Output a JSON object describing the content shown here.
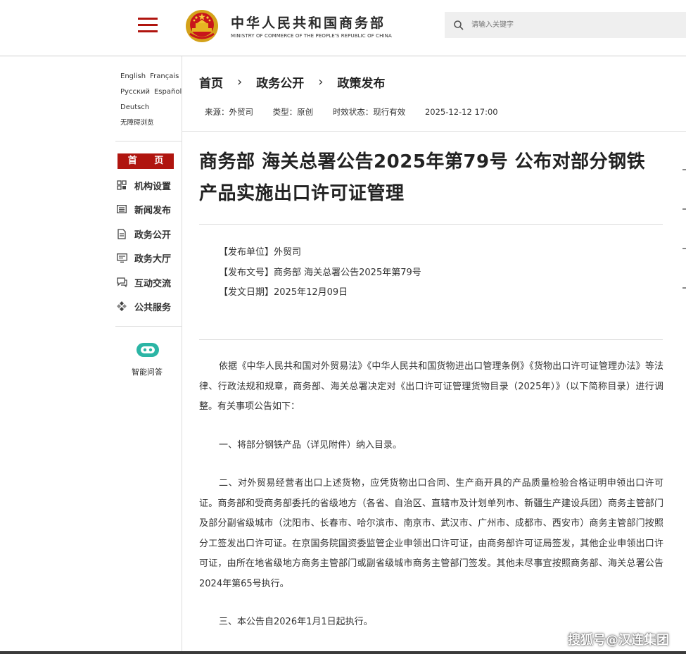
{
  "header": {
    "site_name_cn": "中华人民共和国商务部",
    "site_name_en": "MINISTRY OF COMMERCE OF THE PEOPLE'S REPUBLIC OF CHINA",
    "search_placeholder": "请输入关键字"
  },
  "sidebar": {
    "languages": [
      "English",
      "Français",
      "Русский",
      "Español",
      "Deutsch"
    ],
    "accessibility": "无障碍浏览",
    "home": "首 页",
    "nav": [
      {
        "label": "机构设置",
        "icon": "org-structure-icon"
      },
      {
        "label": "新闻发布",
        "icon": "news-icon"
      },
      {
        "label": "政务公开",
        "icon": "document-icon"
      },
      {
        "label": "政务大厅",
        "icon": "service-hall-icon"
      },
      {
        "label": "互动交流",
        "icon": "chat-icon"
      },
      {
        "label": "公共服务",
        "icon": "public-service-icon"
      }
    ],
    "assistant_label": "智能问答"
  },
  "breadcrumb": [
    "首页",
    "政务公开",
    "政策发布"
  ],
  "meta": {
    "source": "来源：外贸司",
    "type": "类型：原创",
    "status": "时效状态：现行有效",
    "date": "2025-12-12 17:00"
  },
  "article": {
    "title": "商务部 海关总署公告2025年第79号 公布对部分钢铁产品实施出口许可证管理",
    "info": [
      "【发布单位】外贸司",
      "【发布文号】商务部 海关总署公告2025年第79号",
      "【发文日期】2025年12月09日"
    ],
    "paragraphs": [
      "依据《中华人民共和国对外贸易法》《中华人民共和国货物进出口管理条例》《货物出口许可证管理办法》等法律、行政法规和规章，商务部、海关总署决定对《出口许可证管理货物目录（2025年）》（以下简称目录）进行调整。有关事项公告如下：",
      "一、将部分钢铁产品（详见附件）纳入目录。",
      "二、对外贸易经营者出口上述货物，应凭货物出口合同、生产商开具的产品质量检验合格证明申领出口许可证。商务部和受商务部委托的省级地方（各省、自治区、直辖市及计划单列市、新疆生产建设兵团）商务主管部门及部分副省级城市（沈阳市、长春市、哈尔滨市、南京市、武汉市、广州市、成都市、西安市）商务主管部门按照分工签发出口许可证。在京国务院国资委监管企业申领出口许可证，由商务部许可证局签发，其他企业申领出口许可证，由所在地省级地方商务主管部门或副省级城市商务主管部门签发。其他未尽事宜按照商务部、海关总署公告2024年第65号执行。",
      "三、本公告自2026年1月1日起执行。"
    ]
  },
  "watermark": "搜狐号@汉连集团",
  "colors": {
    "brand_red": "#b0150f",
    "search_bg": "#efefef"
  }
}
